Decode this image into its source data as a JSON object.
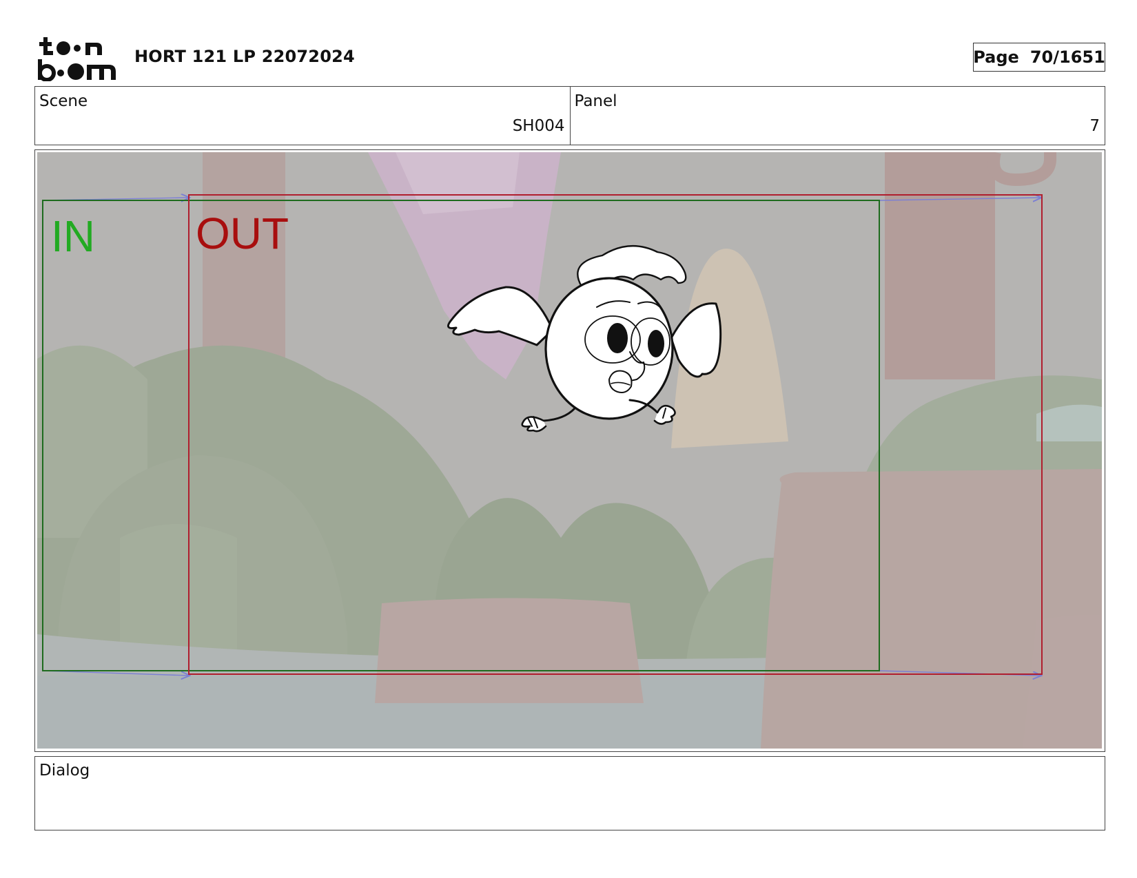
{
  "header": {
    "logo_text": "toon boom",
    "title": "HORT 121 LP 22072024",
    "page_label": "Page",
    "page_value": "70/1651"
  },
  "info": {
    "scene_label": "Scene",
    "scene_value": "SH004",
    "panel_label": "Panel",
    "panel_value": "7"
  },
  "panel": {
    "in_label": "IN",
    "out_label": "OUT",
    "colors": {
      "in_frame": "#1e6b1e",
      "in_text": "#22aa22",
      "out_frame": "#b01e2e",
      "out_text": "#a80e0e",
      "motion_arrow": "#7b7fd4"
    }
  },
  "dialog": {
    "label": "Dialog",
    "text": ""
  }
}
